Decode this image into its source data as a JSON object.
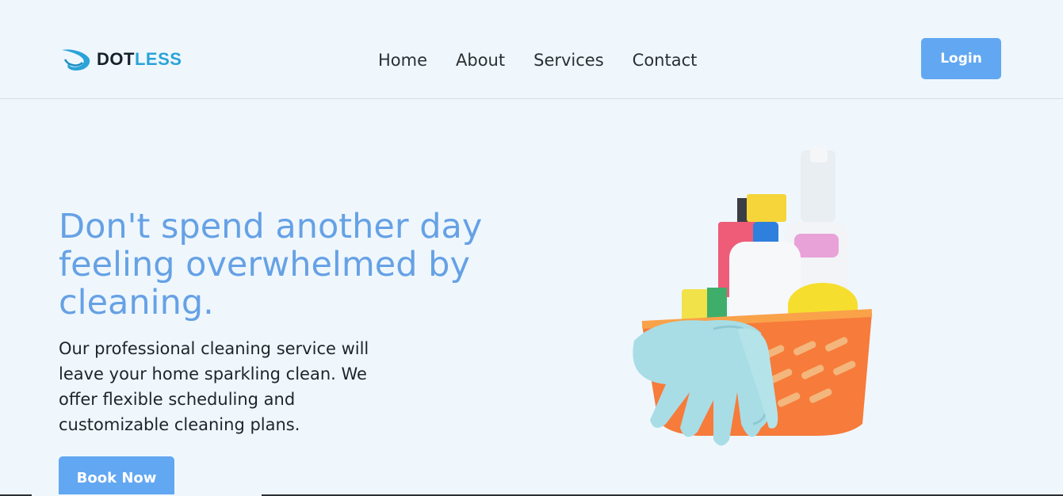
{
  "brand": {
    "name_dark": "DOT",
    "name_light": "LESS",
    "logo_icon": "swoosh-icon"
  },
  "nav": {
    "items": [
      "Home",
      "About",
      "Services",
      "Contact"
    ]
  },
  "header": {
    "login_label": "Login"
  },
  "hero": {
    "title": "Don't spend another day feeling overwhelmed by cleaning.",
    "description": "Our professional cleaning service will leave your home sparkling clean. We offer flexible scheduling and customizable cleaning plans.",
    "cta_label": "Book Now",
    "image_subject": "cleaning-supplies-basket"
  },
  "colors": {
    "background": "#eff7fd",
    "accent": "#62a7f2",
    "title": "#66a1e5",
    "logo_light": "#2aa3d8"
  }
}
